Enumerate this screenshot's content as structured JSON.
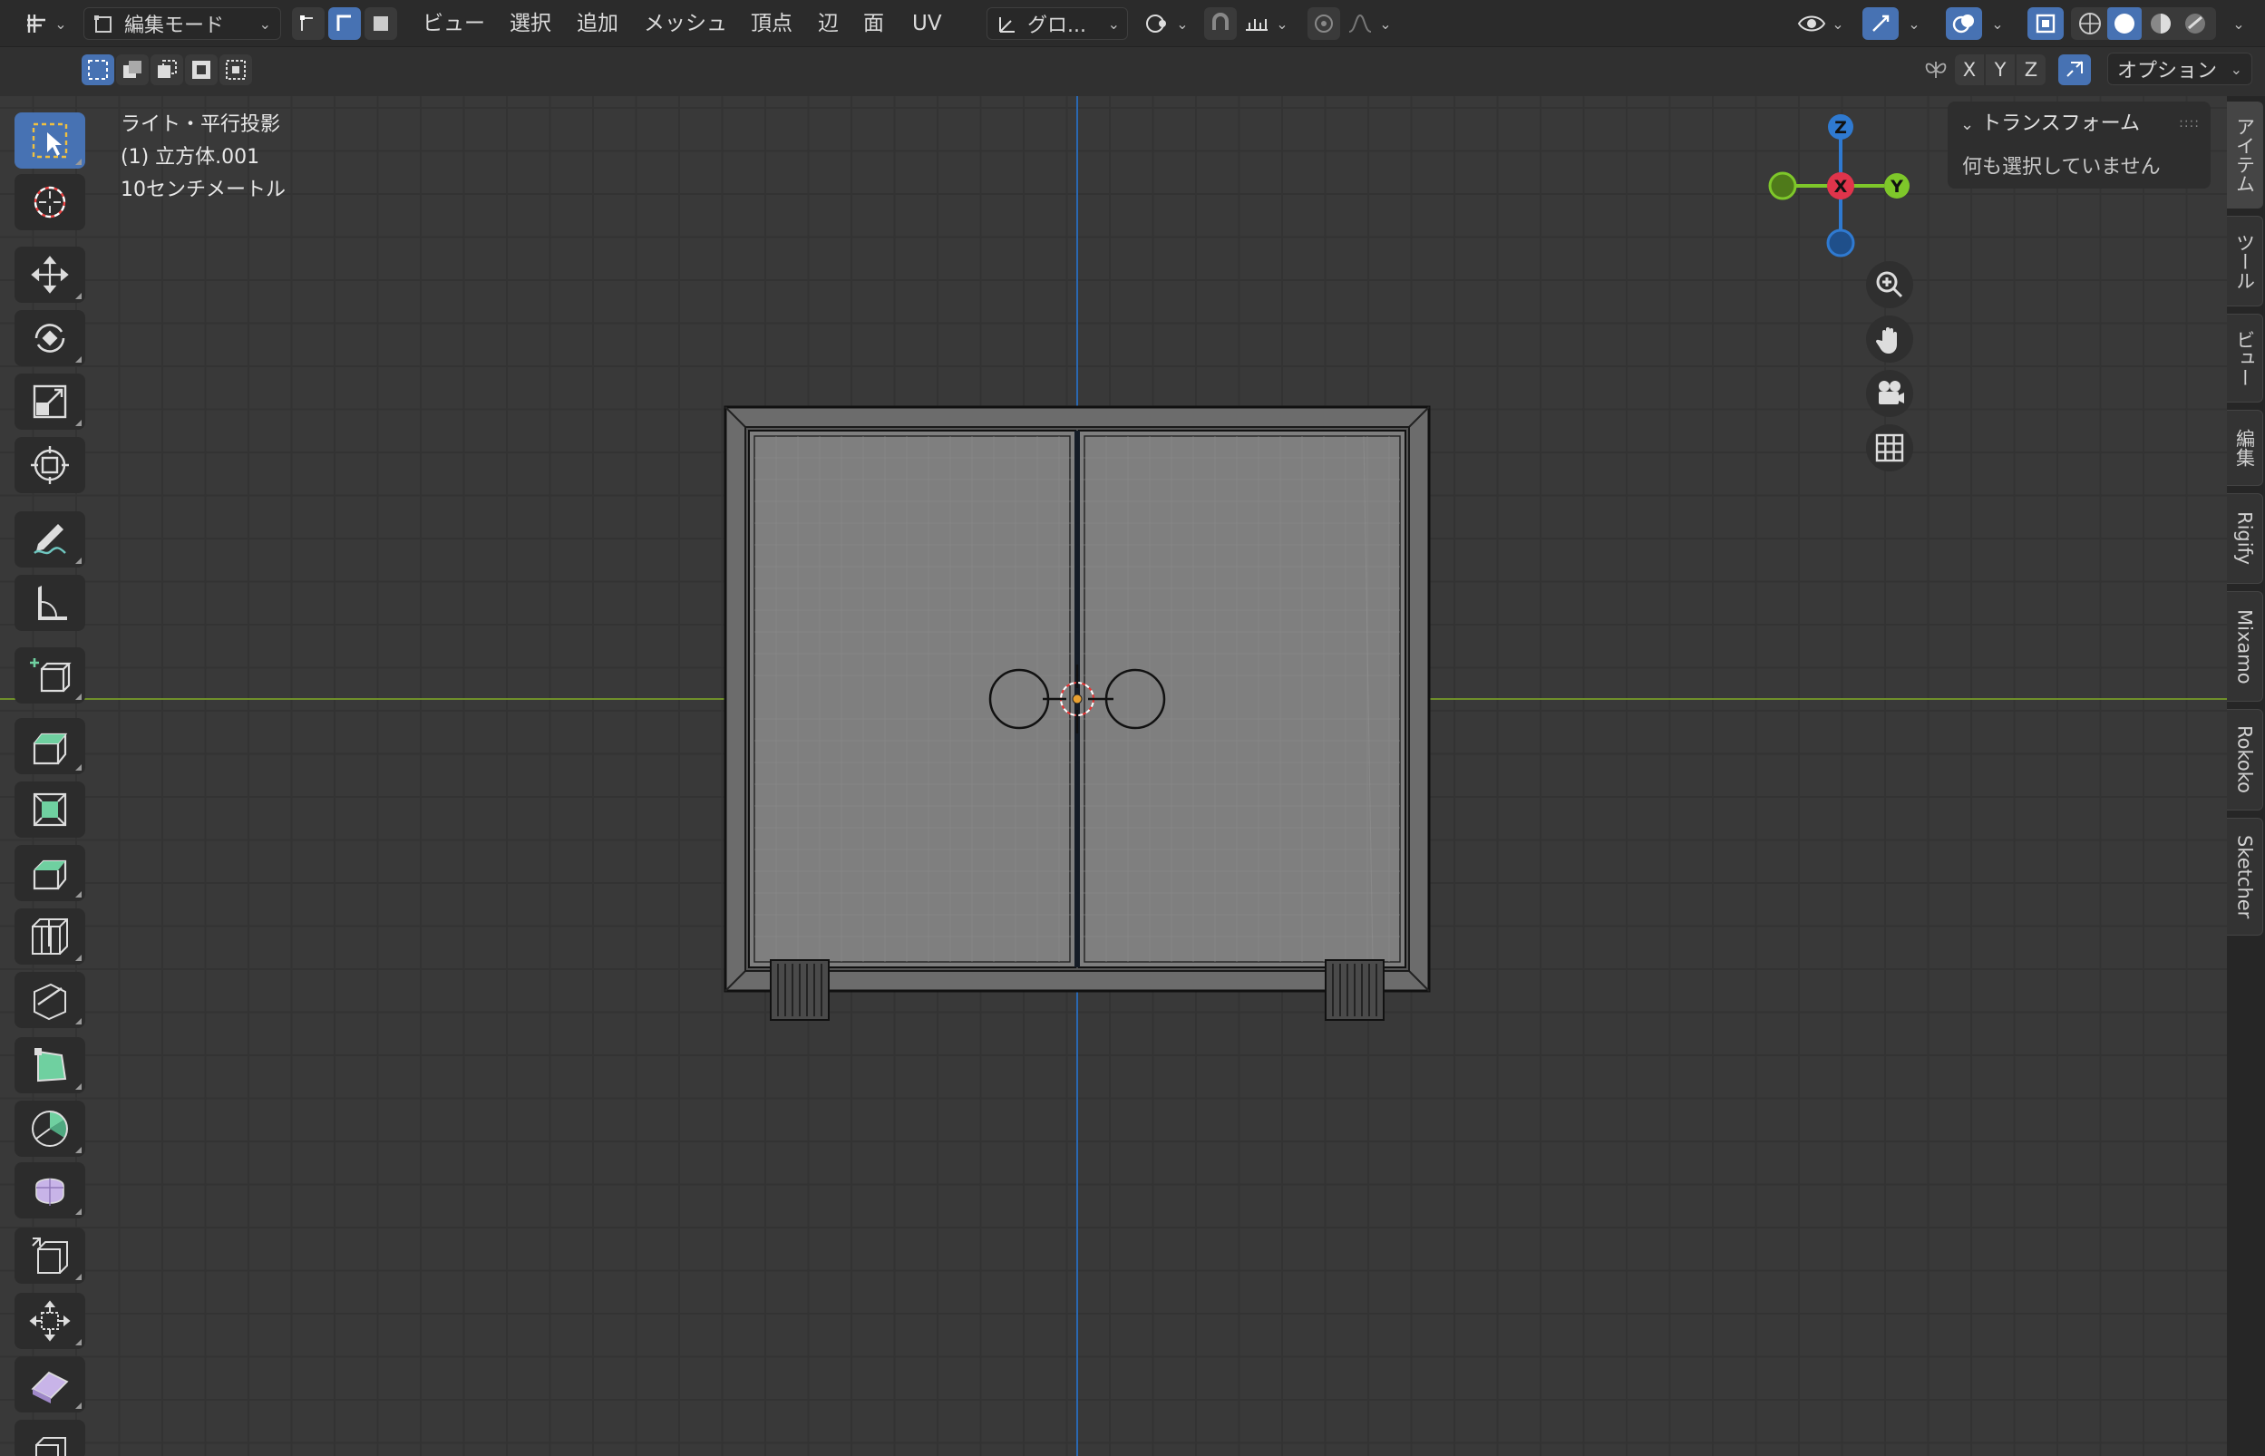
{
  "header": {
    "mode_label": "編集モード",
    "menus": [
      "ビュー",
      "選択",
      "追加",
      "メッシュ",
      "頂点",
      "辺",
      "面",
      "UV"
    ],
    "transform_orientation": "グロ..."
  },
  "subbar": {
    "axes": [
      "X",
      "Y",
      "Z"
    ],
    "options_label": "オプション"
  },
  "viewport": {
    "view_name": "ライト・平行投影",
    "object_name": "(1) 立方体.001",
    "scale": "10センチメートル"
  },
  "gizmo": {
    "z": "Z",
    "x": "X",
    "y": "Y"
  },
  "npanel": {
    "title": "トランスフォーム",
    "body": "何も選択していません"
  },
  "tabs": [
    "アイテム",
    "ツール",
    "ビュー",
    "編集",
    "Rigify",
    "Mixamo",
    "Rokoko",
    "Sketcher"
  ],
  "colors": {
    "accent": "#4772b3",
    "axis_x": "#e0344b",
    "axis_y": "#7ec72a",
    "axis_z": "#2f7ad1",
    "floor_line": "#6f8f2a",
    "mesh_face": "#7f7f7f"
  }
}
